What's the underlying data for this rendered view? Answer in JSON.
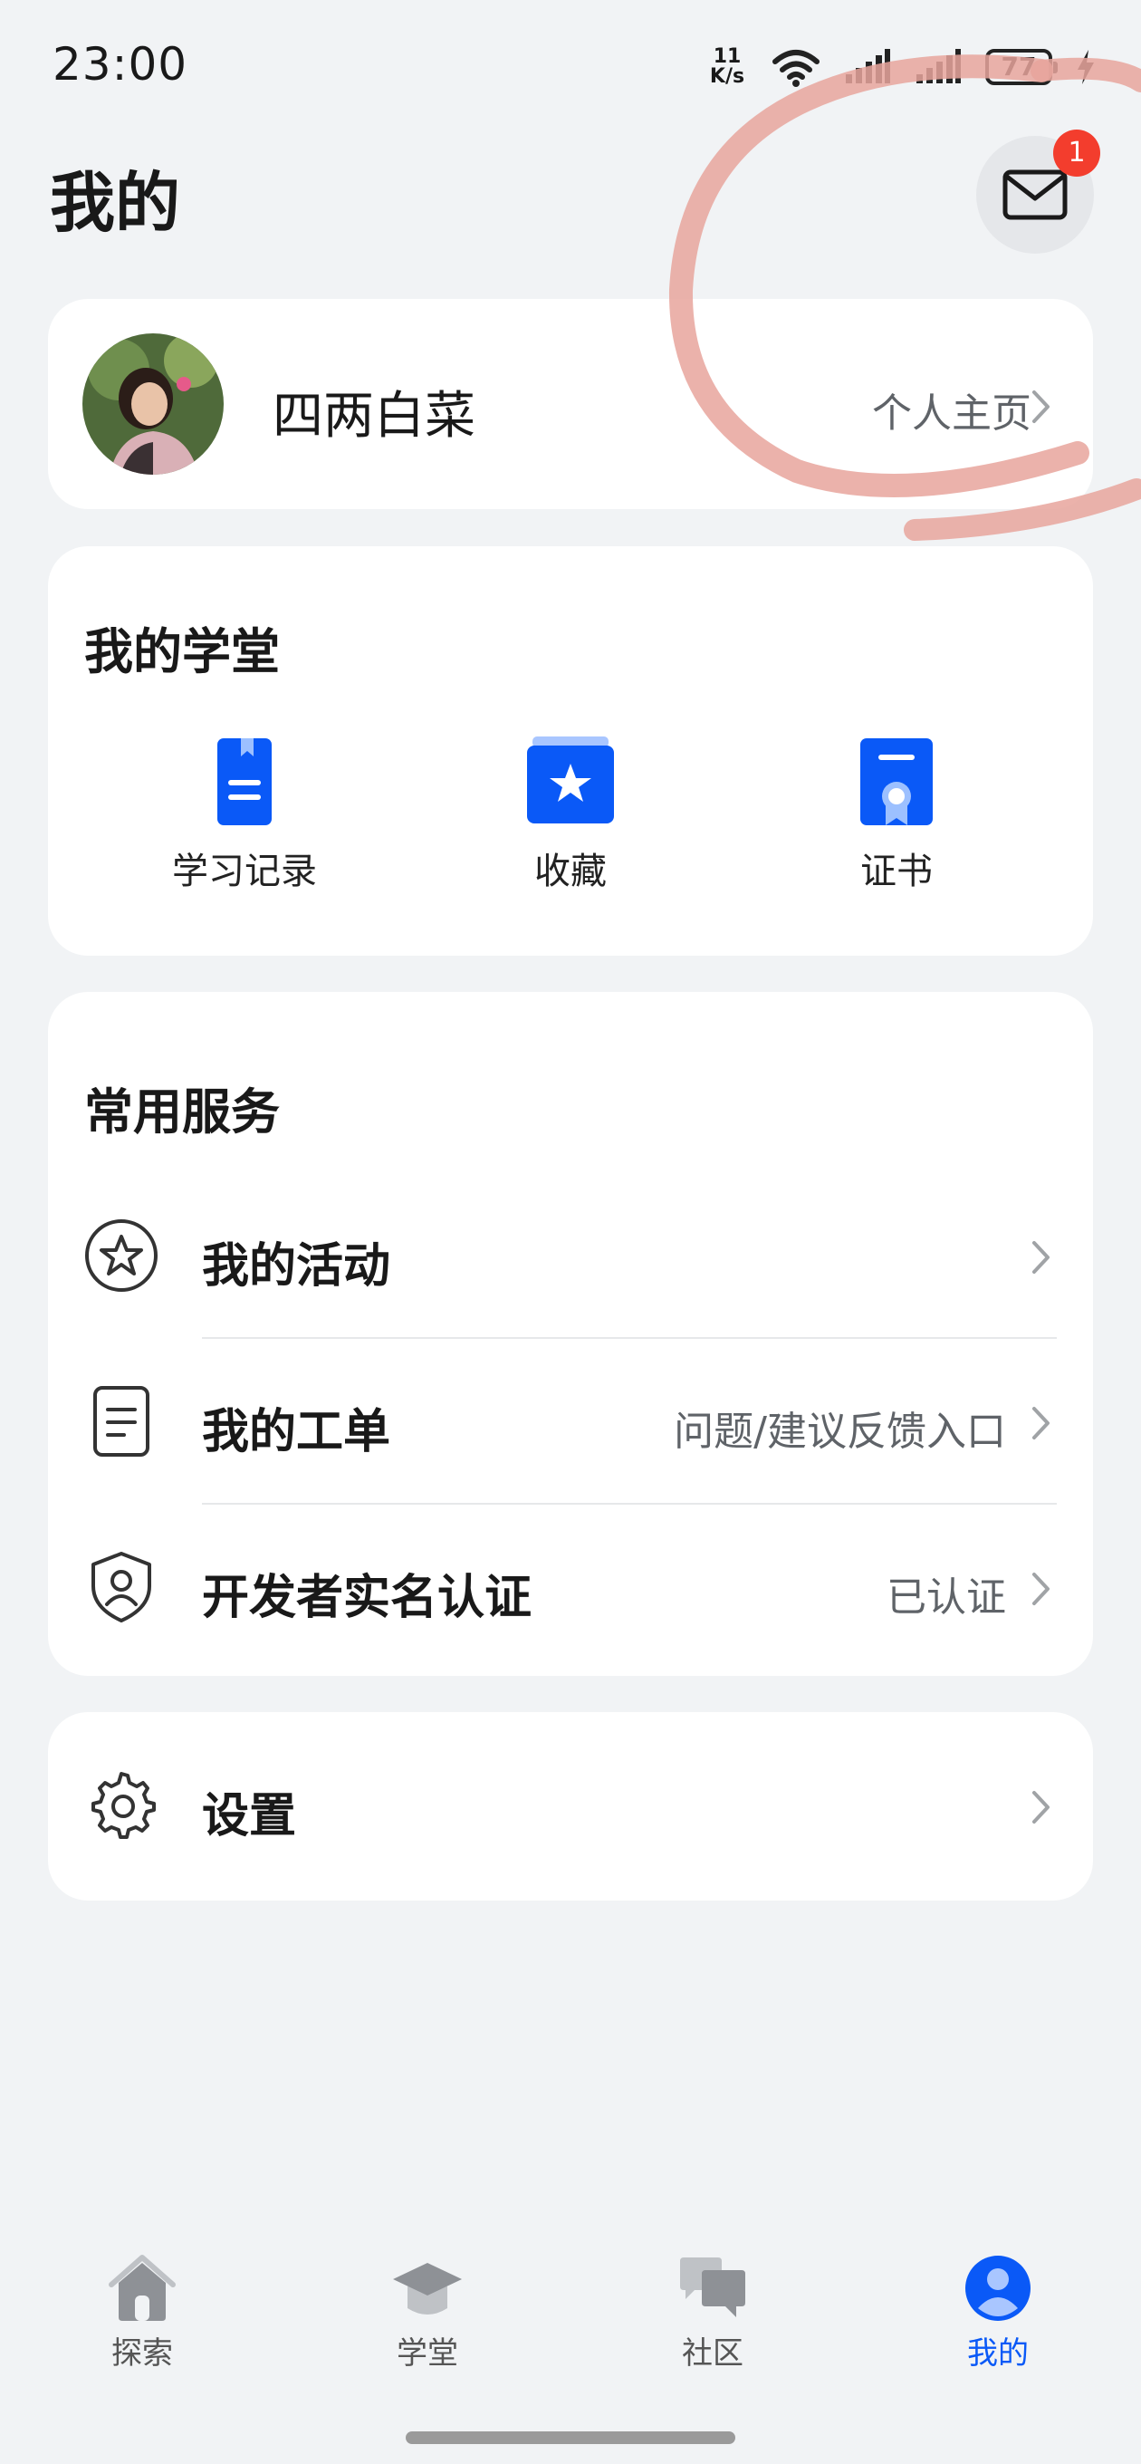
{
  "status_bar": {
    "time": "23:00",
    "net_speed_value": "11",
    "net_speed_unit": "K/s",
    "battery": "77"
  },
  "header": {
    "title": "我的",
    "mail_badge_count": "1"
  },
  "profile": {
    "name": "四两白菜",
    "link_label": "个人主页"
  },
  "my_school": {
    "title": "我的学堂",
    "items": [
      {
        "label": "学习记录",
        "icon": "study-record-icon"
      },
      {
        "label": "收藏",
        "icon": "favorite-icon"
      },
      {
        "label": "证书",
        "icon": "certificate-icon"
      }
    ]
  },
  "services": {
    "title": "常用服务",
    "items": [
      {
        "label": "我的活动",
        "detail": "",
        "icon": "star-icon"
      },
      {
        "label": "我的工单",
        "detail": "问题/建议反馈入口",
        "icon": "document-icon"
      },
      {
        "label": "开发者实名认证",
        "detail": "已认证",
        "icon": "shield-user-icon"
      }
    ]
  },
  "settings": {
    "label": "设置",
    "icon": "gear-icon"
  },
  "tab_bar": {
    "items": [
      {
        "label": "探索",
        "icon": "home-icon",
        "active": false
      },
      {
        "label": "学堂",
        "icon": "graduation-cap-icon",
        "active": false
      },
      {
        "label": "社区",
        "icon": "chat-bubbles-icon",
        "active": false
      },
      {
        "label": "我的",
        "icon": "user-icon",
        "active": true
      }
    ]
  },
  "colors": {
    "accent": "#0a59f7",
    "badge": "#f33d2d",
    "background": "#f1f3f5",
    "annotation_stroke": "#e8a59c"
  }
}
